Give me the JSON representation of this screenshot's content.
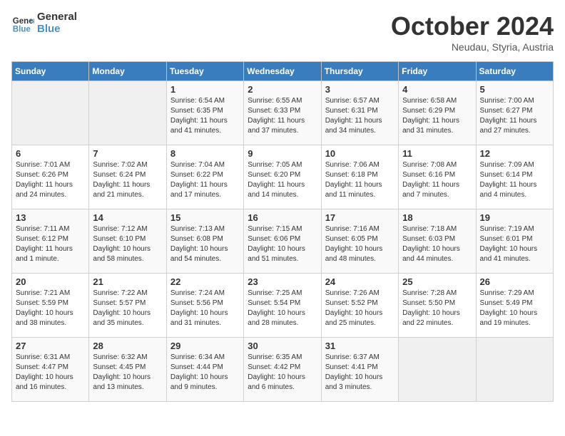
{
  "header": {
    "logo_line1": "General",
    "logo_line2": "Blue",
    "month": "October 2024",
    "location": "Neudau, Styria, Austria"
  },
  "weekdays": [
    "Sunday",
    "Monday",
    "Tuesday",
    "Wednesday",
    "Thursday",
    "Friday",
    "Saturday"
  ],
  "weeks": [
    [
      {
        "day": "",
        "info": ""
      },
      {
        "day": "",
        "info": ""
      },
      {
        "day": "1",
        "info": "Sunrise: 6:54 AM\nSunset: 6:35 PM\nDaylight: 11 hours and 41 minutes."
      },
      {
        "day": "2",
        "info": "Sunrise: 6:55 AM\nSunset: 6:33 PM\nDaylight: 11 hours and 37 minutes."
      },
      {
        "day": "3",
        "info": "Sunrise: 6:57 AM\nSunset: 6:31 PM\nDaylight: 11 hours and 34 minutes."
      },
      {
        "day": "4",
        "info": "Sunrise: 6:58 AM\nSunset: 6:29 PM\nDaylight: 11 hours and 31 minutes."
      },
      {
        "day": "5",
        "info": "Sunrise: 7:00 AM\nSunset: 6:27 PM\nDaylight: 11 hours and 27 minutes."
      }
    ],
    [
      {
        "day": "6",
        "info": "Sunrise: 7:01 AM\nSunset: 6:26 PM\nDaylight: 11 hours and 24 minutes."
      },
      {
        "day": "7",
        "info": "Sunrise: 7:02 AM\nSunset: 6:24 PM\nDaylight: 11 hours and 21 minutes."
      },
      {
        "day": "8",
        "info": "Sunrise: 7:04 AM\nSunset: 6:22 PM\nDaylight: 11 hours and 17 minutes."
      },
      {
        "day": "9",
        "info": "Sunrise: 7:05 AM\nSunset: 6:20 PM\nDaylight: 11 hours and 14 minutes."
      },
      {
        "day": "10",
        "info": "Sunrise: 7:06 AM\nSunset: 6:18 PM\nDaylight: 11 hours and 11 minutes."
      },
      {
        "day": "11",
        "info": "Sunrise: 7:08 AM\nSunset: 6:16 PM\nDaylight: 11 hours and 7 minutes."
      },
      {
        "day": "12",
        "info": "Sunrise: 7:09 AM\nSunset: 6:14 PM\nDaylight: 11 hours and 4 minutes."
      }
    ],
    [
      {
        "day": "13",
        "info": "Sunrise: 7:11 AM\nSunset: 6:12 PM\nDaylight: 11 hours and 1 minute."
      },
      {
        "day": "14",
        "info": "Sunrise: 7:12 AM\nSunset: 6:10 PM\nDaylight: 10 hours and 58 minutes."
      },
      {
        "day": "15",
        "info": "Sunrise: 7:13 AM\nSunset: 6:08 PM\nDaylight: 10 hours and 54 minutes."
      },
      {
        "day": "16",
        "info": "Sunrise: 7:15 AM\nSunset: 6:06 PM\nDaylight: 10 hours and 51 minutes."
      },
      {
        "day": "17",
        "info": "Sunrise: 7:16 AM\nSunset: 6:05 PM\nDaylight: 10 hours and 48 minutes."
      },
      {
        "day": "18",
        "info": "Sunrise: 7:18 AM\nSunset: 6:03 PM\nDaylight: 10 hours and 44 minutes."
      },
      {
        "day": "19",
        "info": "Sunrise: 7:19 AM\nSunset: 6:01 PM\nDaylight: 10 hours and 41 minutes."
      }
    ],
    [
      {
        "day": "20",
        "info": "Sunrise: 7:21 AM\nSunset: 5:59 PM\nDaylight: 10 hours and 38 minutes."
      },
      {
        "day": "21",
        "info": "Sunrise: 7:22 AM\nSunset: 5:57 PM\nDaylight: 10 hours and 35 minutes."
      },
      {
        "day": "22",
        "info": "Sunrise: 7:24 AM\nSunset: 5:56 PM\nDaylight: 10 hours and 31 minutes."
      },
      {
        "day": "23",
        "info": "Sunrise: 7:25 AM\nSunset: 5:54 PM\nDaylight: 10 hours and 28 minutes."
      },
      {
        "day": "24",
        "info": "Sunrise: 7:26 AM\nSunset: 5:52 PM\nDaylight: 10 hours and 25 minutes."
      },
      {
        "day": "25",
        "info": "Sunrise: 7:28 AM\nSunset: 5:50 PM\nDaylight: 10 hours and 22 minutes."
      },
      {
        "day": "26",
        "info": "Sunrise: 7:29 AM\nSunset: 5:49 PM\nDaylight: 10 hours and 19 minutes."
      }
    ],
    [
      {
        "day": "27",
        "info": "Sunrise: 6:31 AM\nSunset: 4:47 PM\nDaylight: 10 hours and 16 minutes."
      },
      {
        "day": "28",
        "info": "Sunrise: 6:32 AM\nSunset: 4:45 PM\nDaylight: 10 hours and 13 minutes."
      },
      {
        "day": "29",
        "info": "Sunrise: 6:34 AM\nSunset: 4:44 PM\nDaylight: 10 hours and 9 minutes."
      },
      {
        "day": "30",
        "info": "Sunrise: 6:35 AM\nSunset: 4:42 PM\nDaylight: 10 hours and 6 minutes."
      },
      {
        "day": "31",
        "info": "Sunrise: 6:37 AM\nSunset: 4:41 PM\nDaylight: 10 hours and 3 minutes."
      },
      {
        "day": "",
        "info": ""
      },
      {
        "day": "",
        "info": ""
      }
    ]
  ]
}
